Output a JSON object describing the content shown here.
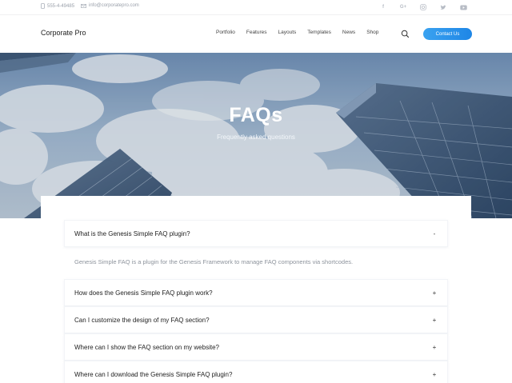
{
  "topbar": {
    "phone": "555-4-49485",
    "email": "info@corporatepro.com",
    "socials": [
      "facebook-icon",
      "google-plus-icon",
      "instagram-icon",
      "twitter-icon",
      "youtube-icon"
    ]
  },
  "header": {
    "brand": "Corporate Pro",
    "nav": [
      "Portfolio",
      "Features",
      "Layouts",
      "Templates",
      "News",
      "Shop"
    ],
    "cta": "Contact Us"
  },
  "hero": {
    "title": "FAQs",
    "subtitle": "Frequently asked questions"
  },
  "faq": [
    {
      "question": "What is the Genesis Simple FAQ plugin?",
      "toggle": "-",
      "answer": "Genesis Simple FAQ is a plugin for the Genesis Framework to manage FAQ components via shortcodes."
    },
    {
      "question": "How does the Genesis Simple FAQ plugin work?",
      "toggle": "+"
    },
    {
      "question": "Can I customize the design of my FAQ section?",
      "toggle": "+"
    },
    {
      "question": "Where can I show the FAQ section on my website?",
      "toggle": "+"
    },
    {
      "question": "Where can I download the Genesis Simple FAQ plugin?",
      "toggle": "+"
    }
  ],
  "colors": {
    "accent": "#2c95ec",
    "text": "#222222",
    "muted": "#8d939c"
  }
}
